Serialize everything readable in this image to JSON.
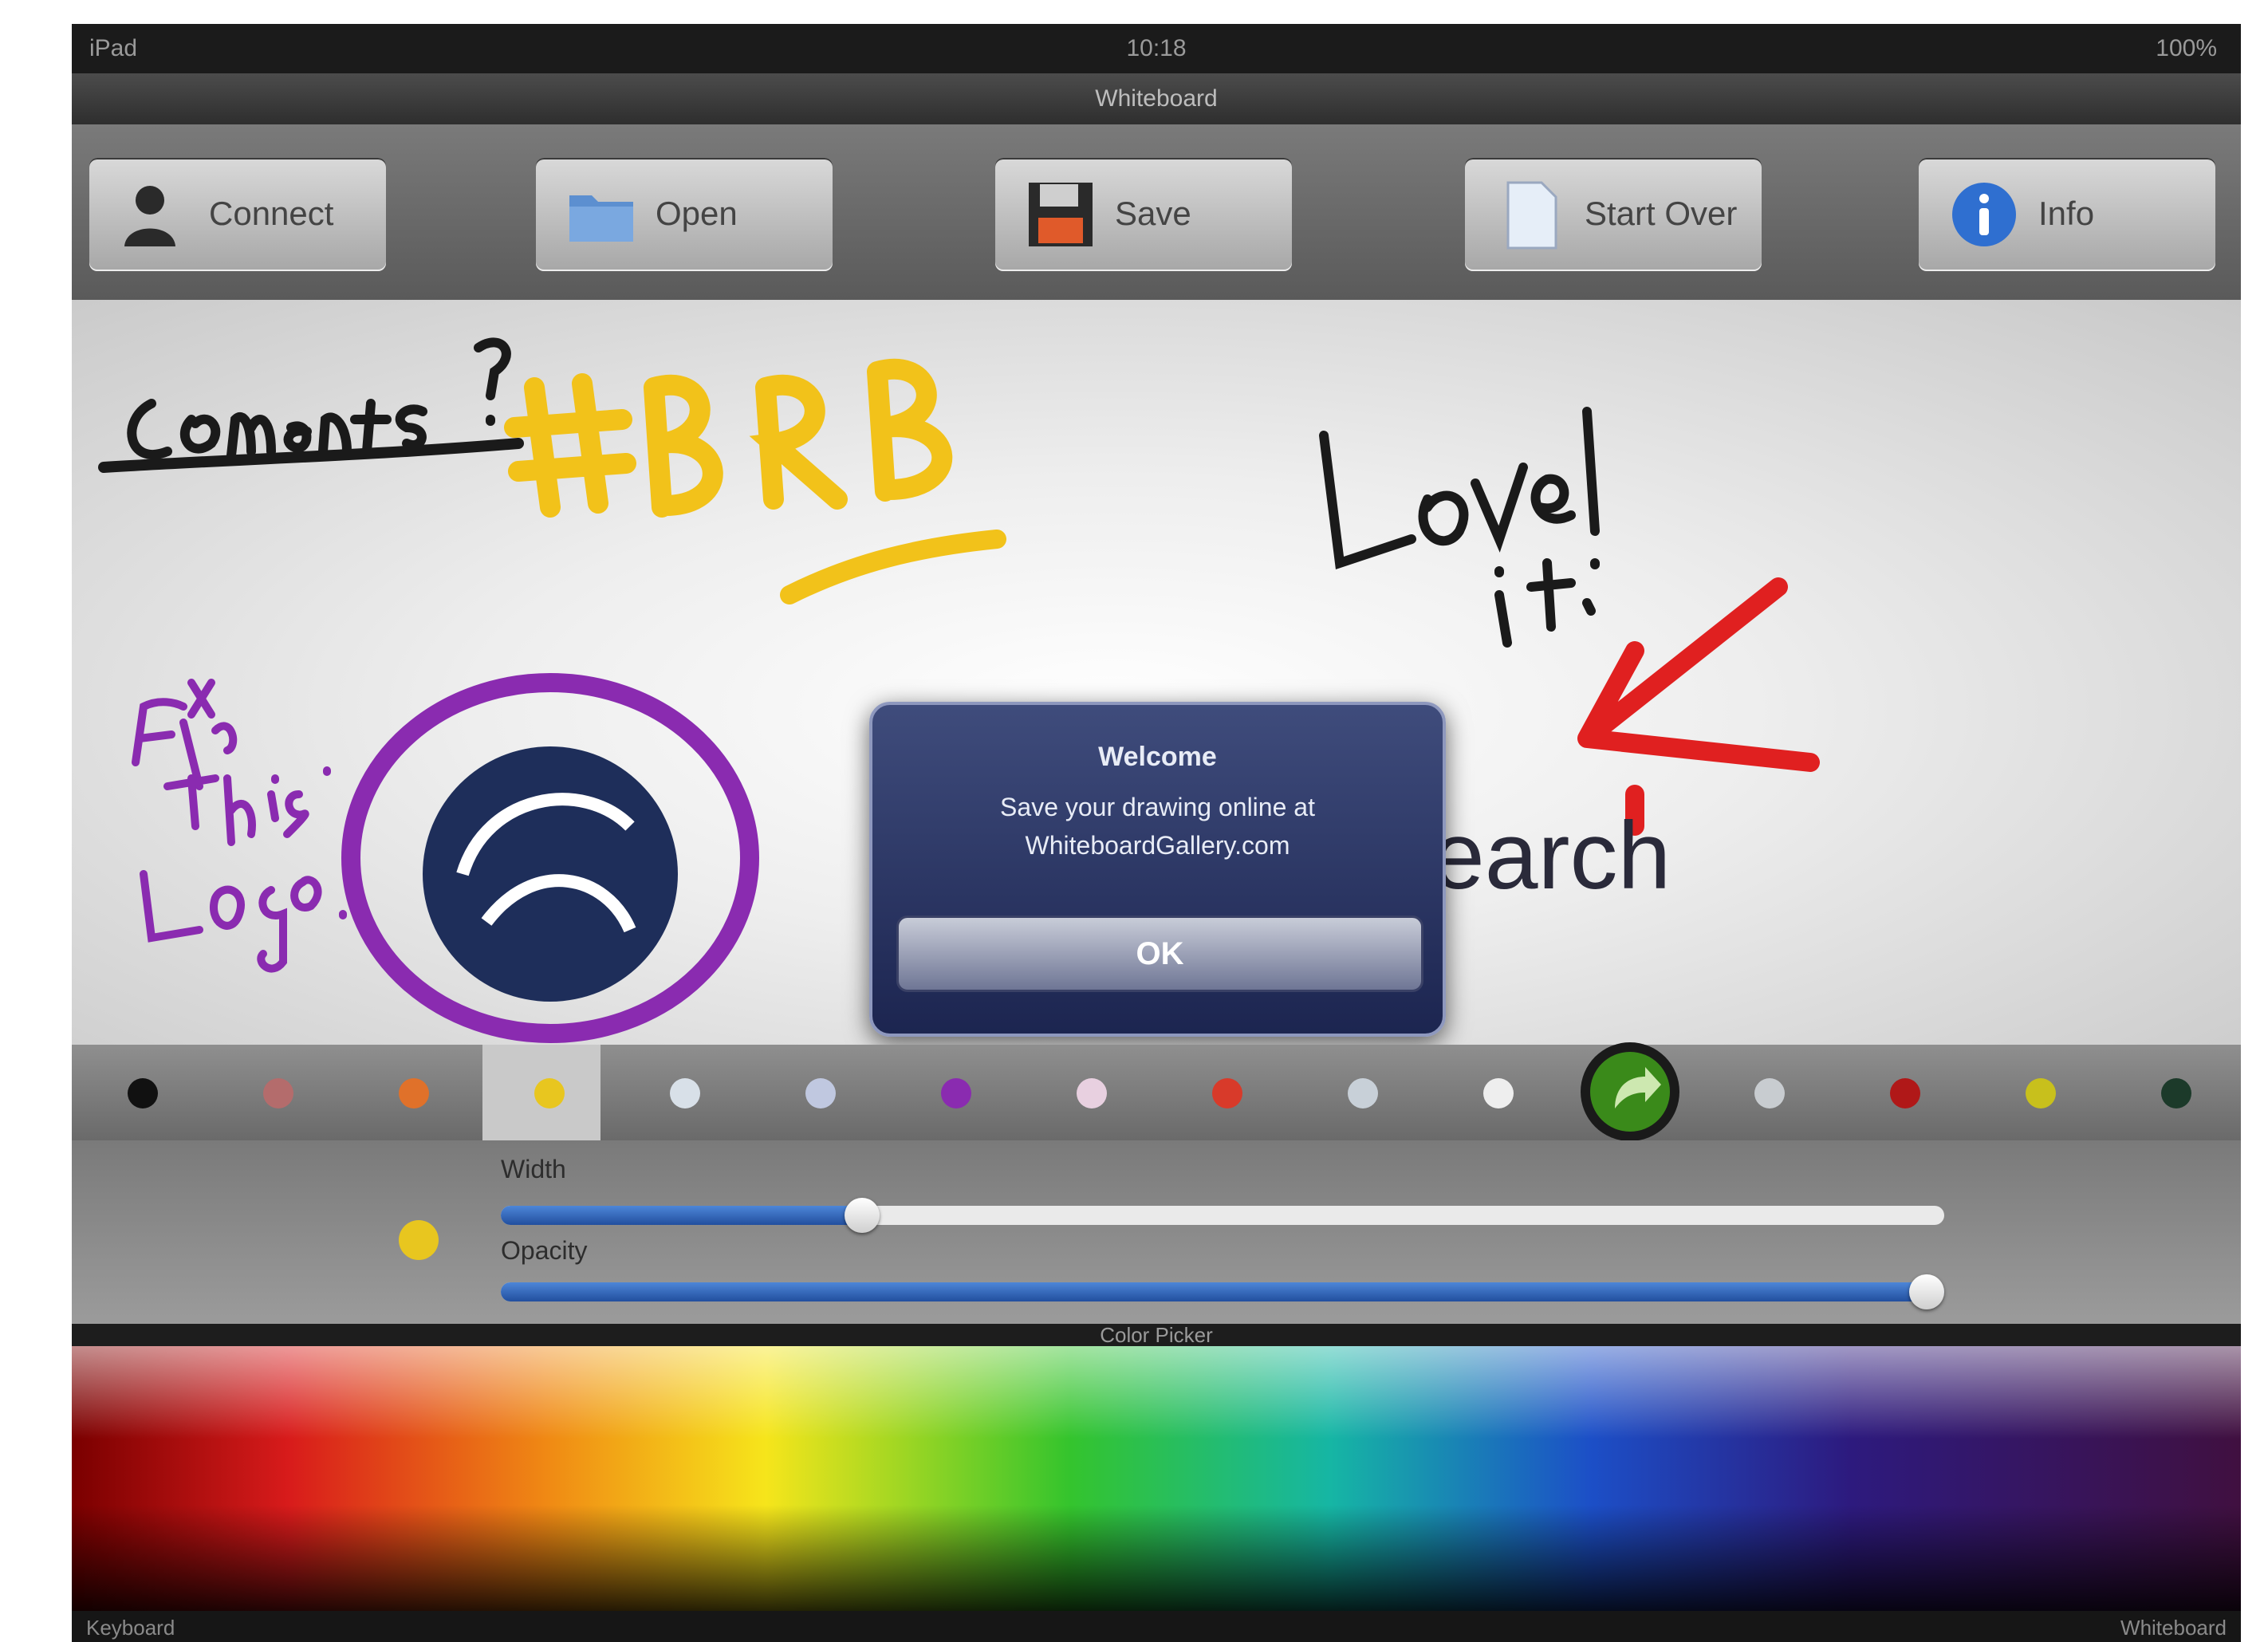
{
  "status_bar": {
    "carrier": "iPad",
    "time": "10:18",
    "battery": "100%"
  },
  "title": "Whiteboard",
  "toolbar": {
    "buttons": [
      {
        "label": "Connect",
        "icon": "user-icon"
      },
      {
        "label": "Open",
        "icon": "folder-icon"
      },
      {
        "label": "Save",
        "icon": "floppy-disk-icon"
      },
      {
        "label": "Start Over",
        "icon": "blank-page-icon"
      },
      {
        "label": "Info",
        "icon": "info-icon"
      }
    ]
  },
  "canvas": {
    "logo_text": "earch",
    "colors": {
      "black_ink": "#1a1a1a",
      "yellow_ink": "#f2c21a",
      "purple_ink": "#8a2bb0",
      "red_ink": "#e02020"
    }
  },
  "dialog": {
    "title": "Welcome",
    "message_line1": "Save your drawing online at",
    "message_line2": "WhiteboardGallery.com",
    "ok_label": "OK"
  },
  "palette": {
    "selected_index": 3,
    "swatches": [
      "#111111",
      "#b46c6c",
      "#e0712a",
      "#e8c61f",
      "#d8e0e8",
      "#c0c8e0",
      "#8a2bb0",
      "#e8d0e0",
      "#d83a2a",
      "#c8d0d8",
      "#eeeeee",
      "#c8ccd0",
      "#b01818",
      "#c8c01c",
      "#1c3a2a"
    ]
  },
  "settings": {
    "width_label": "Width",
    "width_value": 0.25,
    "opacity_label": "Opacity",
    "opacity_value": 1.0,
    "current_color": "#e8c61f"
  },
  "picker": {
    "label": "Color Picker"
  },
  "bottom_bar": {
    "left": "Keyboard",
    "right": "Whiteboard"
  }
}
